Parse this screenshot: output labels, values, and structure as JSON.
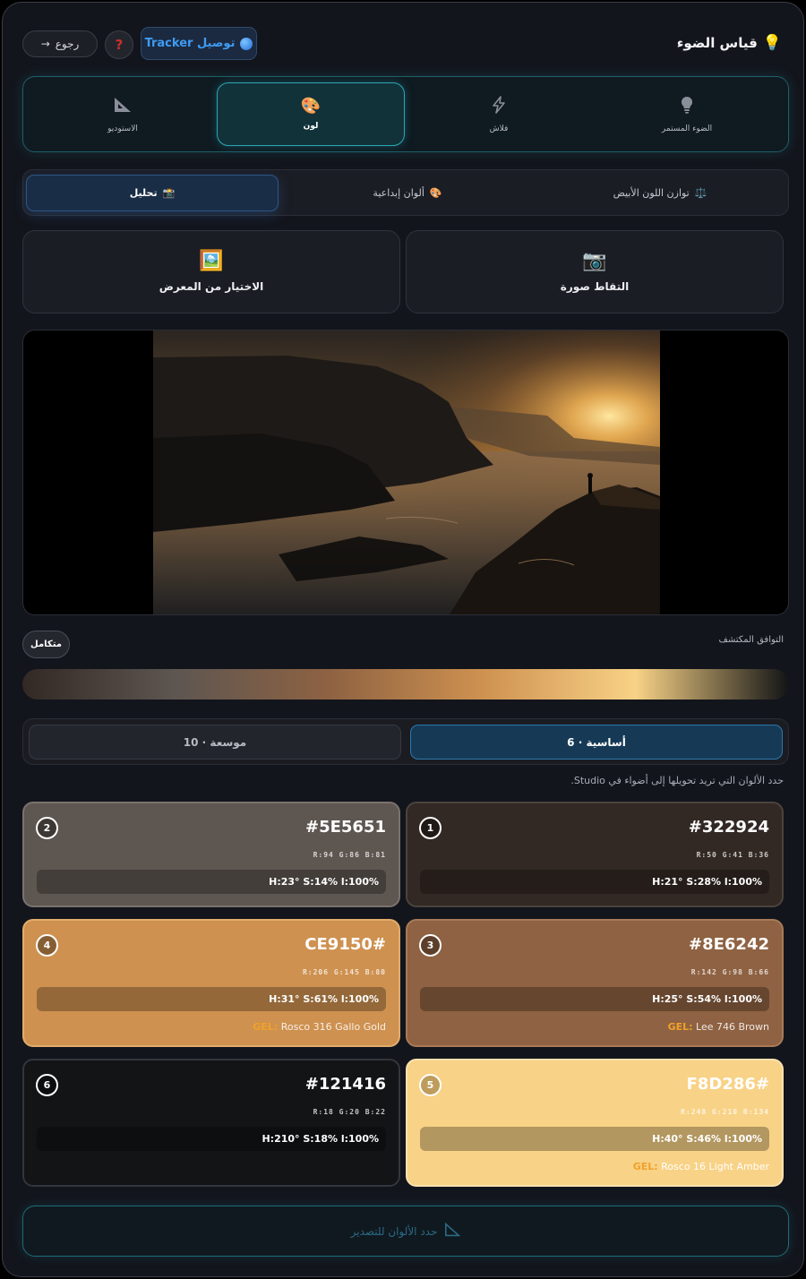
{
  "header": {
    "title": "قياس الضوء",
    "title_icon": "lightbulb-icon",
    "tracker_label": "توصيل Tracker",
    "help_label": "?",
    "back_label": "رجوع",
    "back_arrow": "→"
  },
  "modes": [
    {
      "label": "الضوء المستمر",
      "icon": "bulb-icon"
    },
    {
      "label": "فلاش",
      "icon": "lightning-icon"
    },
    {
      "label": "لون",
      "icon": "palette-icon",
      "active": true
    },
    {
      "label": "الاستوديو",
      "icon": "set-square-icon"
    }
  ],
  "sub_tabs": [
    {
      "label": "توازن اللون الأبيض",
      "icon": "scale-icon"
    },
    {
      "label": "ألوان إبداعية",
      "icon": "palette-icon"
    },
    {
      "label": "تحليل",
      "icon": "camera-flash-icon",
      "active": true
    }
  ],
  "source": {
    "capture_label": "التقاط صورة",
    "gallery_label": "الاختيار من المعرض"
  },
  "harmony": {
    "label": "التوافق المكتشف",
    "badge": "متكامل"
  },
  "gradient_colors": [
    "#322924",
    "#5E5651",
    "#8E6242",
    "#CE9150",
    "#F8D286",
    "#121416"
  ],
  "palette_tabs": {
    "basic_label": "أساسية · 6",
    "extended_label": "موسعة · 10"
  },
  "hint": "حدد الألوان التي تريد تحويلها إلى أضواء في Studio.",
  "swatches": [
    {
      "num": "1",
      "hex": "#322924",
      "rgb": "R:50 G:41 B:36",
      "hsl": "H:21° S:28% l:100%",
      "gel_prefix": "",
      "gel": ""
    },
    {
      "num": "2",
      "hex": "#5E5651",
      "rgb": "R:94 G:86 B:81",
      "hsl": "H:23° S:14% l:100%",
      "gel_prefix": "",
      "gel": ""
    },
    {
      "num": "3",
      "hex": "#8E6242",
      "rgb": "R:142 G:98 B:66",
      "hsl": "H:25° S:54% l:100%",
      "gel_prefix": "GEL:",
      "gel": "Lee 746 Brown"
    },
    {
      "num": "4",
      "hex": "#CE9150",
      "rgb": "R:206 G:145 B:80",
      "hsl": "H:31° S:61% l:100%",
      "gel_prefix": "GEL:",
      "gel": "Rosco 316 Gallo Gold"
    },
    {
      "num": "5",
      "hex": "#F8D286",
      "rgb": "R:248 G:210 B:134",
      "hsl": "H:40° S:46% l:100%",
      "gel_prefix": "GEL:",
      "gel": "Rosco 16 Light Amber"
    },
    {
      "num": "6",
      "hex": "#121416",
      "rgb": "R:18 G:20 B:22",
      "hsl": "H:210° S:18% l:100%",
      "gel_prefix": "",
      "gel": ""
    }
  ],
  "export_label": "حدد الألوان للتصدير"
}
